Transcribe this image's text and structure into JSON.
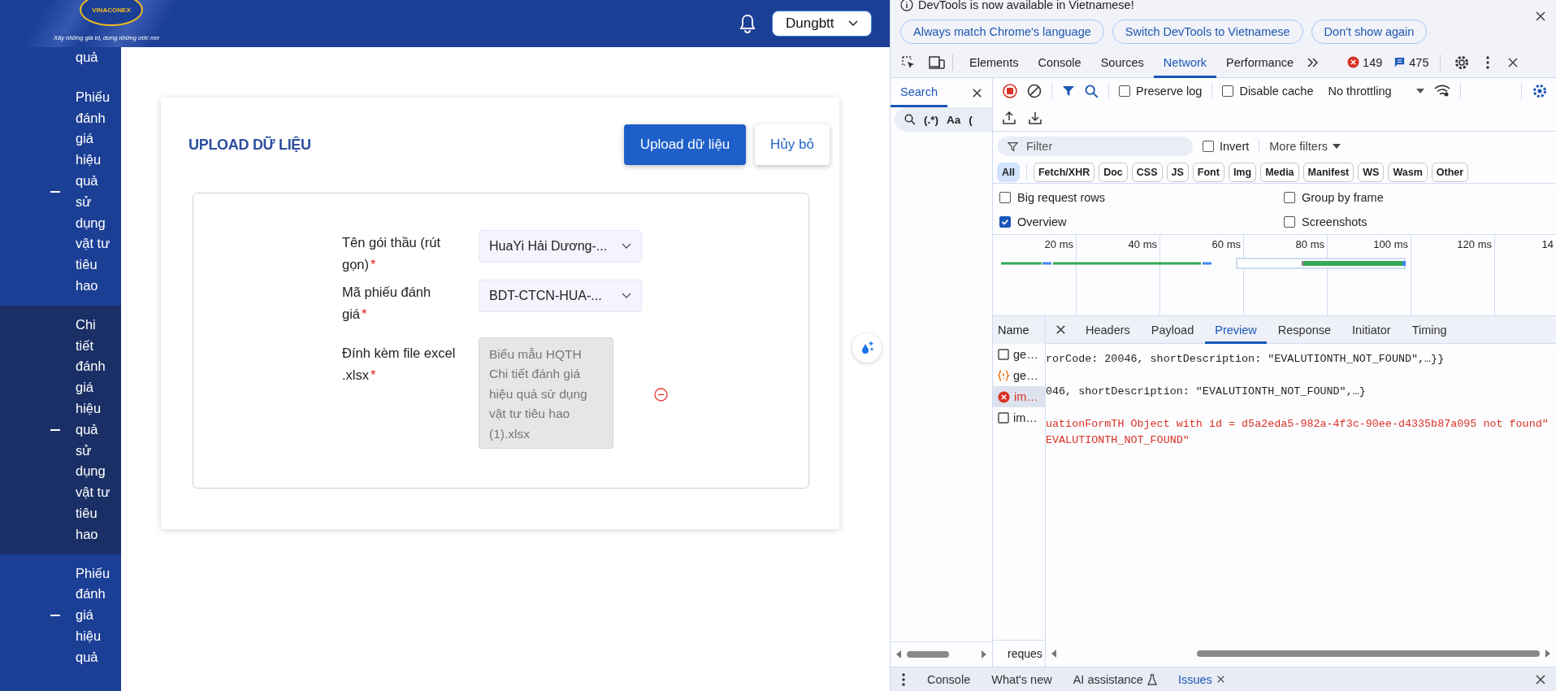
{
  "app": {
    "logo": {
      "name": "VINACONEX",
      "tagline": "Xây những giá trị, dựng những ước mơ"
    },
    "user_menu": {
      "label": "Dungbtt"
    },
    "sidebar": {
      "items": [
        {
          "label": "quả",
          "selected": false,
          "bullet": false
        },
        {
          "label": "Phiếu đánh giá hiệu quả sử dụng vật tư tiêu hao",
          "selected": false,
          "bullet": true
        },
        {
          "label": "Chi tiết đánh giá hiệu quả sử dụng vật tư tiêu hao",
          "selected": true,
          "bullet": true
        },
        {
          "label": "Phiếu đánh giá hiệu quả",
          "selected": false,
          "bullet": true
        }
      ]
    },
    "form": {
      "title": "UPLOAD DỮ LIỆU",
      "buttons": [
        {
          "label": "Upload dữ liệu",
          "kind": "primary"
        },
        {
          "label": "Hủy bỏ",
          "kind": "secondary"
        }
      ],
      "fields": [
        {
          "kind": "select",
          "label": "Tên gói thầu (rút gọn)",
          "required_mark": "*",
          "value": "HuaYi Hải Dương-..."
        },
        {
          "kind": "select",
          "label": "Mã phiếu đánh giá",
          "required_mark": "*",
          "value": "BDT-CTCN-HUA-..."
        },
        {
          "kind": "file",
          "label": "Đính kèm file excel .xlsx",
          "required_mark": "*",
          "value": "Biểu mẫu HQTH Chi tiết đánh giá hiệu quả sử dụng vật tư tiêu hao (1).xlsx"
        }
      ]
    }
  },
  "devtools": {
    "infobar": {
      "message": "DevTools is now available in Vietnamese!",
      "buttons": [
        "Always match Chrome's language",
        "Switch DevTools to Vietnamese",
        "Don't show again"
      ]
    },
    "tabs": [
      {
        "label": "Elements",
        "selected": false
      },
      {
        "label": "Console",
        "selected": false
      },
      {
        "label": "Sources",
        "selected": false
      },
      {
        "label": "Network",
        "selected": true
      },
      {
        "label": "Performance",
        "selected": false
      }
    ],
    "error_count": "149",
    "message_count": "475",
    "search_panel": {
      "tab": "Search",
      "options": [
        "(.*)",
        "Aa",
        "("
      ]
    },
    "toolbar": {
      "checkboxes": [
        {
          "label": "Preserve log",
          "checked": false
        },
        {
          "label": "Disable cache",
          "checked": false
        }
      ],
      "throttling": "No throttling"
    },
    "filter": {
      "placeholder": "Filter",
      "invert": {
        "label": "Invert",
        "checked": false
      },
      "more_filters": "More filters"
    },
    "types": [
      {
        "label": "All",
        "selected": true
      },
      {
        "label": "Fetch/XHR",
        "selected": false
      },
      {
        "label": "Doc",
        "selected": false
      },
      {
        "label": "CSS",
        "selected": false
      },
      {
        "label": "JS",
        "selected": false
      },
      {
        "label": "Font",
        "selected": false
      },
      {
        "label": "Img",
        "selected": false
      },
      {
        "label": "Media",
        "selected": false
      },
      {
        "label": "Manifest",
        "selected": false
      },
      {
        "label": "WS",
        "selected": false
      },
      {
        "label": "Wasm",
        "selected": false
      },
      {
        "label": "Other",
        "selected": false
      }
    ],
    "options": [
      {
        "label": "Big request rows",
        "checked": false
      },
      {
        "label": "Group by frame",
        "checked": false
      },
      {
        "label": "Overview",
        "checked": true
      },
      {
        "label": "Screenshots",
        "checked": false
      }
    ],
    "overview": {
      "ticks": [
        "20 ms",
        "40 ms",
        "60 ms",
        "80 ms",
        "100 ms",
        "120 ms",
        "14"
      ]
    },
    "requests": {
      "column": "Name",
      "rows": [
        {
          "name": "ge…",
          "kind": "document",
          "selected": false
        },
        {
          "name": "ge…",
          "kind": "json",
          "selected": false
        },
        {
          "name": "im…",
          "kind": "error",
          "selected": true
        },
        {
          "name": "im…",
          "kind": "document",
          "selected": false
        }
      ],
      "footer": "reques"
    },
    "details": {
      "tabs": [
        {
          "label": "Headers",
          "selected": false
        },
        {
          "label": "Payload",
          "selected": false
        },
        {
          "label": "Preview",
          "selected": true
        },
        {
          "label": "Response",
          "selected": false
        },
        {
          "label": "Initiator",
          "selected": false
        },
        {
          "label": "Timing",
          "selected": false
        }
      ],
      "lines": [
        {
          "kind": "object",
          "text": "rorCode: 20046, shortDescription: \"EVALUTIONTH_NOT_FOUND\",…}}"
        },
        {
          "kind": "object",
          "text": "046, shortDescription: \"EVALUTIONTH_NOT_FOUND\",…}"
        },
        {
          "kind": "error",
          "text": "uationFormTH Object with id = d5a2eda5-982a-4f3c-90ee-d4335b87a095 not found\""
        },
        {
          "kind": "error",
          "text": "EVALUTIONTH_NOT_FOUND\""
        }
      ]
    },
    "drawer": {
      "tabs": [
        {
          "label": "Console",
          "selected": false,
          "experimental": false,
          "closable": false
        },
        {
          "label": "What's new",
          "selected": false,
          "experimental": false,
          "closable": false
        },
        {
          "label": "AI assistance",
          "selected": false,
          "experimental": true,
          "closable": false
        },
        {
          "label": "Issues",
          "selected": true,
          "experimental": false,
          "closable": true
        }
      ]
    }
  }
}
